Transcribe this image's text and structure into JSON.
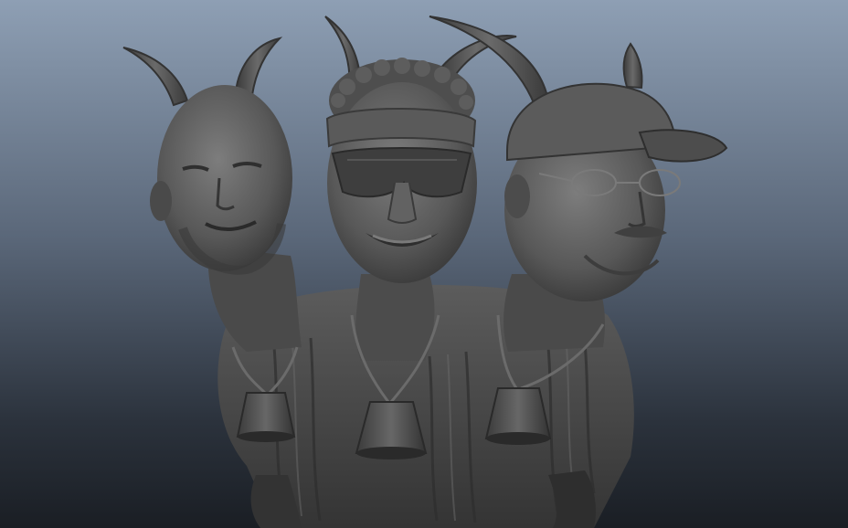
{
  "scene": {
    "subject": "three-headed-goat-creature-sculpt",
    "background_top_color": "#8e9fb4",
    "background_bottom_color": "#1a1e24",
    "clay_light": "#6e6e6e",
    "clay_mid": "#4b4b4b",
    "clay_dark": "#262626",
    "icons": [
      "goat-horn",
      "cowbell",
      "baseball-cap",
      "sunglasses",
      "headband",
      "eyeglasses"
    ]
  }
}
